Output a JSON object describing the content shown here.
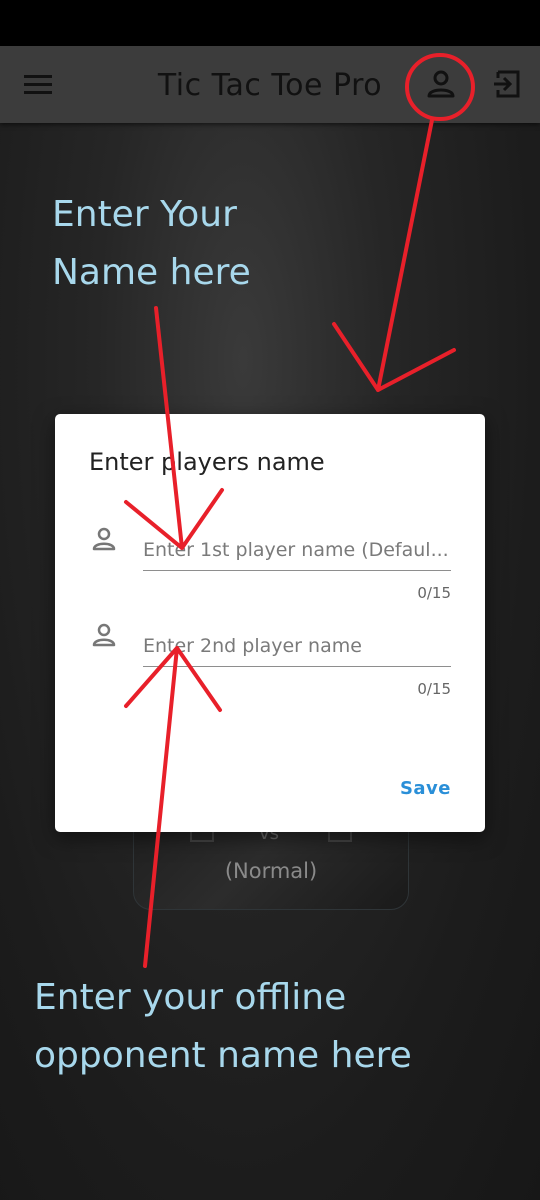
{
  "app_bar": {
    "title": "Tic Tac Toe Pro",
    "menu_icon": "hamburger-menu-icon",
    "profile_icon": "person-icon",
    "logout_icon": "exit-icon",
    "bg_color": "#3c3c3c"
  },
  "background_card": {
    "vs_label": "vs",
    "mode": "(Normal)"
  },
  "dialog": {
    "title": "Enter players name",
    "player1": {
      "placeholder": "Enter 1st player name (Defaul...",
      "value": "",
      "counter": "0/15",
      "icon": "person-icon"
    },
    "player2": {
      "placeholder": "Enter 2nd player name",
      "value": "",
      "counter": "0/15",
      "icon": "person-icon"
    },
    "save_label": "Save",
    "accent_color": "#2a8fd8"
  },
  "annotations": {
    "top_line1": "Enter Your",
    "top_line2": "Name here",
    "bottom_line1": "Enter your offline",
    "bottom_line2": "opponent name here",
    "text_color": "#a8d8ec",
    "arrow_color": "#e8202a"
  }
}
